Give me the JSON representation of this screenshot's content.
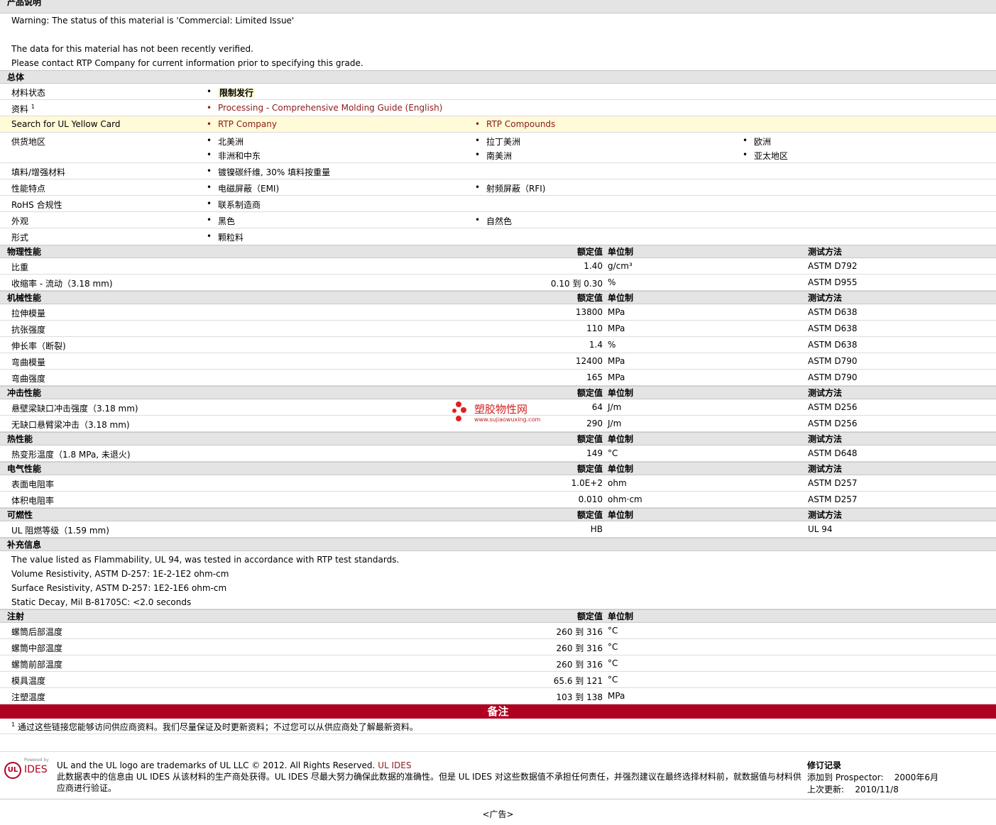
{
  "product_desc": {
    "title": "产品说明",
    "lines": [
      "Warning: The status of this material is 'Commercial: Limited Issue'",
      "",
      "The data for this material has not been recently verified.",
      "Please contact RTP Company for current information prior to specifying this grade."
    ]
  },
  "general": {
    "title": "总体",
    "status_label": "材料状态",
    "status_value": "限制发行",
    "docs_label": "资料",
    "docs_sup": "1",
    "docs_link": "Processing - Comprehensive Molding Guide (English)",
    "ul_label": "Search for UL Yellow Card",
    "ul_link1": "RTP Company",
    "ul_link2": "RTP Compounds",
    "region_label": "供货地区",
    "regions": [
      "北美洲",
      "拉丁美洲",
      "欧洲",
      "非洲和中东",
      "南美洲",
      "亚太地区"
    ],
    "filler_label": "填料/增强材料",
    "filler_value": "镀镍碳纤维, 30% 填料按重量",
    "features_label": "性能特点",
    "features": [
      "电磁屏蔽（EMI)",
      "射频屏蔽（RFI)"
    ],
    "rohs_label": "RoHS 合规性",
    "rohs_value": "联系制造商",
    "appearance_label": "外观",
    "appearance": [
      "黑色",
      "自然色"
    ],
    "form_label": "形式",
    "form_value": "颗粒料"
  },
  "headers": {
    "nominal": "额定值",
    "unit": "单位制",
    "method": "测试方法"
  },
  "physical": {
    "title": "物理性能",
    "rows": [
      {
        "name": "比重",
        "value": "1.40",
        "unit": "g/cm³",
        "method": "ASTM D792"
      },
      {
        "name": "收缩率 - 流动（3.18 mm)",
        "value": "0.10 到  0.30",
        "unit": "%",
        "method": "ASTM D955"
      }
    ]
  },
  "mechanical": {
    "title": "机械性能",
    "rows": [
      {
        "name": "拉伸模量",
        "value": "13800",
        "unit": "MPa",
        "method": "ASTM D638"
      },
      {
        "name": "抗张强度",
        "value": "110",
        "unit": "MPa",
        "method": "ASTM D638"
      },
      {
        "name": "伸长率（断裂)",
        "value": "1.4",
        "unit": "%",
        "method": "ASTM D638"
      },
      {
        "name": "弯曲模量",
        "value": "12400",
        "unit": "MPa",
        "method": "ASTM D790"
      },
      {
        "name": "弯曲强度",
        "value": "165",
        "unit": "MPa",
        "method": "ASTM D790"
      }
    ]
  },
  "impact": {
    "title": "冲击性能",
    "rows": [
      {
        "name": "悬壁梁缺口冲击强度（3.18 mm)",
        "value": "64",
        "unit": "J/m",
        "method": "ASTM D256"
      },
      {
        "name": "无缺口悬臂梁冲击（3.18 mm)",
        "value": "290",
        "unit": "J/m",
        "method": "ASTM D256"
      }
    ]
  },
  "thermal": {
    "title": "热性能",
    "rows": [
      {
        "name": "热变形温度（1.8 MPa, 未退火)",
        "value": "149",
        "unit": "°C",
        "method": "ASTM D648"
      }
    ]
  },
  "electrical": {
    "title": "电气性能",
    "rows": [
      {
        "name": "表面电阻率",
        "value": "1.0E+2",
        "unit": "ohm",
        "method": "ASTM D257"
      },
      {
        "name": "体积电阻率",
        "value": "0.010",
        "unit": "ohm·cm",
        "method": "ASTM D257"
      }
    ]
  },
  "flammability": {
    "title": "可燃性",
    "rows": [
      {
        "name": "UL 阻燃等级（1.59 mm)",
        "value": "HB",
        "unit": "",
        "method": "UL 94"
      }
    ]
  },
  "supplemental": {
    "title": "补充信息",
    "lines": [
      "The value listed as Flammability, UL 94, was tested in accordance with RTP test standards.",
      "Volume Resistivity, ASTM D-257: 1E-2-1E2 ohm-cm",
      "Surface Resistivity, ASTM D-257: 1E2-1E6 ohm-cm",
      "Static Decay, Mil B-81705C: <2.0 seconds"
    ]
  },
  "injection": {
    "title": "注射",
    "rows": [
      {
        "name": "螺筒后部温度",
        "value": "260 到  316",
        "unit": "°C"
      },
      {
        "name": "螺筒中部温度",
        "value": "260 到  316",
        "unit": "°C"
      },
      {
        "name": "螺筒前部温度",
        "value": "260 到  316",
        "unit": "°C"
      },
      {
        "name": "模具温度",
        "value": "65.6 到  121",
        "unit": "°C"
      },
      {
        "name": "注塑温度",
        "value": "103 到  138",
        "unit": "MPa"
      }
    ]
  },
  "notes": {
    "title": "备注",
    "sup": "1",
    "text": "通过这些链接您能够访问供应商资料。我们尽量保证及时更新资料；不过您可以从供应商处了解最新资料。"
  },
  "watermark": {
    "name": "塑胶物性网",
    "url": "www.sujiaowuxing.com"
  },
  "footer": {
    "logo_powered": "Powered by",
    "logo_ul": "UL",
    "logo_ides": "IDES",
    "trademark": "UL and the UL logo are trademarks of UL LLC © 2012. All Rights Reserved.",
    "ul_ides_link": "UL IDES",
    "disclaimer": "此数据表中的信息由  UL IDES 从该材料的生产商处获得。UL IDES 尽最大努力确保此数据的准确性。但是  UL IDES 对这些数据值不承担任何责任，并强烈建议在最终选择材料前，就数据值与材料供应商进行验证。",
    "revision_title": "修订记录",
    "added_label": "添加到  Prospector:",
    "added_value": "2000年6月",
    "updated_label": "上次更新:",
    "updated_value": "2010/11/8",
    "ad": "<广告>"
  }
}
